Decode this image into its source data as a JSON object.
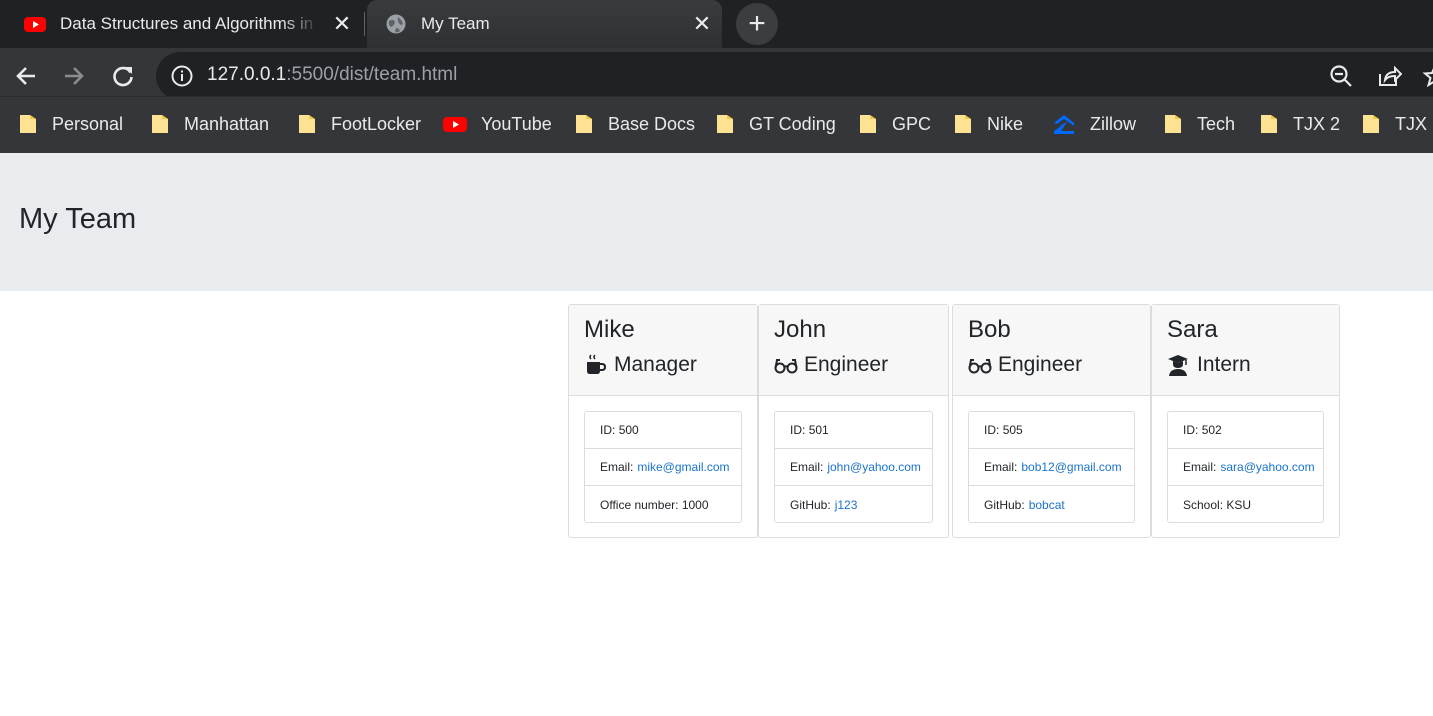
{
  "browser": {
    "tabs": [
      {
        "title": "Data Structures and Algorithms in",
        "favicon": "youtube-icon",
        "active": false
      },
      {
        "title": "My Team",
        "favicon": "globe-icon",
        "active": true
      }
    ],
    "close_glyph": "✕",
    "newtab_glyph": "+",
    "url_host": "127.0.0.1",
    "url_rest": ":5500/dist/team.html",
    "bookmarks": [
      {
        "label": "Personal",
        "icon": "folder-icon"
      },
      {
        "label": "Manhattan",
        "icon": "folder-icon"
      },
      {
        "label": "FootLocker",
        "icon": "folder-icon"
      },
      {
        "label": "YouTube",
        "icon": "youtube-icon"
      },
      {
        "label": "Base Docs",
        "icon": "folder-icon"
      },
      {
        "label": "GT Coding",
        "icon": "folder-icon"
      },
      {
        "label": "GPC",
        "icon": "folder-icon"
      },
      {
        "label": "Nike",
        "icon": "folder-icon"
      },
      {
        "label": "Zillow",
        "icon": "zillow-icon"
      },
      {
        "label": "Tech",
        "icon": "folder-icon"
      },
      {
        "label": "TJX 2",
        "icon": "folder-icon"
      },
      {
        "label": "TJX",
        "icon": "folder-icon"
      }
    ],
    "colors": {
      "tabstrip": "#202124",
      "toolbar": "#35363a",
      "folder": "#fde293",
      "youtube": "#ff0000",
      "zillow": "#006aff"
    }
  },
  "page": {
    "title": "My Team",
    "employees": [
      {
        "name": "Mike",
        "role": "Manager",
        "role_icon": "coffee-mug-icon",
        "id_label": "ID:",
        "id": "500",
        "email_label": "Email:",
        "email": "mike@gmail.com",
        "extra_label": "Office number:",
        "extra_value": "1000",
        "extra_is_link": false
      },
      {
        "name": "John",
        "role": "Engineer",
        "role_icon": "glasses-icon",
        "id_label": "ID:",
        "id": "501",
        "email_label": "Email:",
        "email": "john@yahoo.com",
        "extra_label": "GitHub:",
        "extra_value": "j123",
        "extra_is_link": true
      },
      {
        "name": "Bob",
        "role": "Engineer",
        "role_icon": "glasses-icon",
        "id_label": "ID:",
        "id": "505",
        "email_label": "Email:",
        "email": "bob12@gmail.com",
        "extra_label": "GitHub:",
        "extra_value": "bobcat",
        "extra_is_link": true
      },
      {
        "name": "Sara",
        "role": "Intern",
        "role_icon": "graduate-icon",
        "id_label": "ID:",
        "id": "502",
        "email_label": "Email:",
        "email": "sara@yahoo.com",
        "extra_label": "School:",
        "extra_value": "KSU",
        "extra_is_link": false
      }
    ],
    "link_color": "#1a73c9"
  }
}
